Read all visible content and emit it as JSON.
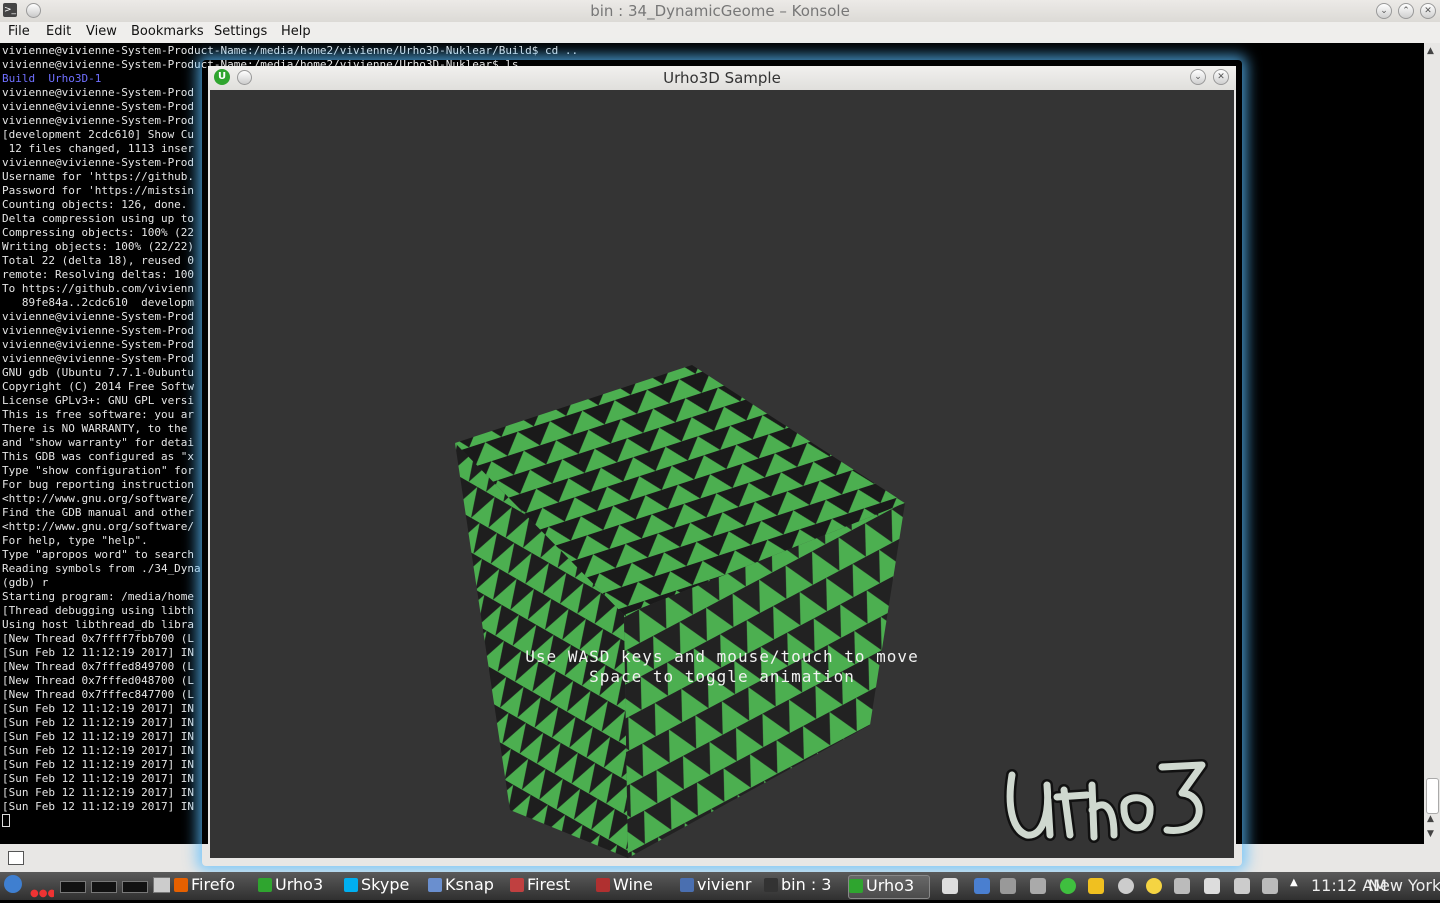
{
  "konsole": {
    "title": "bin : 34_DynamicGeome – Konsole",
    "menu": [
      "File",
      "Edit",
      "View",
      "Bookmarks",
      "Settings",
      "Help"
    ],
    "terminal_lines": [
      "vivienne@vivienne-System-Product-Name:/media/home2/vivienne/Urho3D-Nuklear/Build$ cd ..",
      "vivienne@vivienne-System-Product-Name:/media/home2/vivienne/Urho3D-Nuklear$ ls",
      "Build  Urho3D-1",
      "vivienne@vivienne-System-Prod",
      "vivienne@vivienne-System-Prod",
      "vivienne@vivienne-System-Prod",
      "[development 2cdc610] Show Cu",
      " 12 files changed, 1113 inser",
      "vivienne@vivienne-System-Prod",
      "Username for 'https://github.",
      "Password for 'https://mistsin",
      "Counting objects: 126, done.",
      "Delta compression using up to",
      "Compressing objects: 100% (22",
      "Writing objects: 100% (22/22)",
      "Total 22 (delta 18), reused 0",
      "remote: Resolving deltas: 100",
      "To https://github.com/vivienn",
      "   89fe84a..2cdc610  developm",
      "vivienne@vivienne-System-Prod",
      "vivienne@vivienne-System-Prod",
      "vivienne@vivienne-System-Prod",
      "vivienne@vivienne-System-Prod",
      "GNU gdb (Ubuntu 7.7.1-0ubuntu",
      "Copyright (C) 2014 Free Softw",
      "License GPLv3+: GNU GPL versi",
      "This is free software: you ar",
      "There is NO WARRANTY, to the ",
      "and \"show warranty\" for detai",
      "This GDB was configured as \"x",
      "Type \"show configuration\" for",
      "For bug reporting instruction",
      "<http://www.gnu.org/software/",
      "Find the GDB manual and other",
      "<http://www.gnu.org/software/",
      "For help, type \"help\".",
      "Type \"apropos word\" to search",
      "Reading symbols from ./34_Dyna",
      "(gdb) r",
      "Starting program: /media/home",
      "[Thread debugging using libth",
      "Using host libthread_db libra",
      "[New Thread 0x7ffff7fbb700 (L",
      "[Sun Feb 12 11:12:19 2017] IN",
      "[New Thread 0x7fffed849700 (L",
      "[New Thread 0x7fffed048700 (L",
      "[New Thread 0x7fffec847700 (L",
      "[Sun Feb 12 11:12:19 2017] IN",
      "[Sun Feb 12 11:12:19 2017] IN",
      "[Sun Feb 12 11:12:19 2017] IN",
      "[Sun Feb 12 11:12:19 2017] IN",
      "[Sun Feb 12 11:12:19 2017] IN",
      "[Sun Feb 12 11:12:19 2017] IN",
      "[Sun Feb 12 11:12:19 2017] IN",
      "[Sun Feb 12 11:12:19 2017] IN"
    ],
    "highlight_line_index": 2,
    "highlight_color": "#6f6fff"
  },
  "urho": {
    "title": "Urho3D Sample",
    "hint_line1": "Use WASD keys and mouse/touch to move",
    "hint_line2": "Space to toggle animation",
    "logo_text": "Urho3D",
    "cube_green": "#4caf50",
    "cube_dark": "#1a1a1a",
    "viewport_bg": "#343434"
  },
  "taskbar": {
    "items": [
      {
        "label": "Firefo",
        "icon": "firefox-icon",
        "color": "#e66000"
      },
      {
        "label": "Urho3",
        "icon": "urho-icon",
        "color": "#2fa52f"
      },
      {
        "label": "Skype",
        "icon": "skype-icon",
        "color": "#00aff0"
      },
      {
        "label": "Ksnap",
        "icon": "ksnapshot-icon",
        "color": "#6a8fcf"
      },
      {
        "label": "Firest",
        "icon": "firestorm-icon",
        "color": "#c04040"
      },
      {
        "label": "Wine",
        "icon": "wine-icon",
        "color": "#b03030"
      },
      {
        "label": "vivienr",
        "icon": "document-icon",
        "color": "#4a6fb0"
      },
      {
        "label": "bin : 3",
        "icon": "terminal-icon",
        "color": "#333333"
      },
      {
        "label": "Urho3",
        "icon": "urho-icon",
        "color": "#2fa52f"
      }
    ],
    "clock": "11:12 AM",
    "timezone": "New York"
  }
}
